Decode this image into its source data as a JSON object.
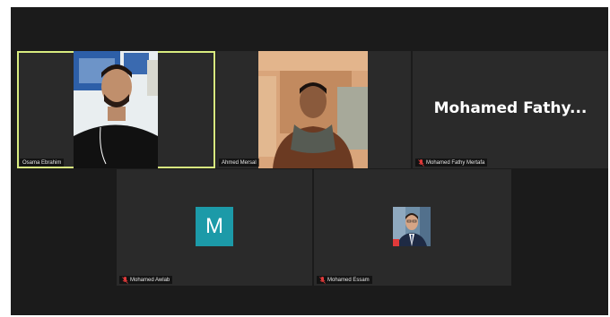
{
  "meeting": {
    "participants": [
      {
        "name": "Osama Ebrahim",
        "muted": false,
        "speaking": true,
        "display": "video"
      },
      {
        "name": "Ahmed Mersal",
        "muted": false,
        "speaking": false,
        "display": "video"
      },
      {
        "name": "Mohamed Fathy Mertafa",
        "muted": true,
        "speaking": false,
        "display": "name",
        "big_label": "Mohamed  Fathy..."
      },
      {
        "name": "Mohamed Awlab",
        "muted": true,
        "speaking": false,
        "display": "initial",
        "initial": "M",
        "avatar_color": "#1c9aa8"
      },
      {
        "name": "Mohamed Essam",
        "muted": true,
        "speaking": false,
        "display": "photo"
      }
    ]
  },
  "colors": {
    "background": "#1b1b1b",
    "tile": "#2a2a2a",
    "speaking_outline": "#d8ec7f",
    "mute_icon": "#e03a3a"
  },
  "icons": {
    "mute": "microphone-off-icon"
  }
}
